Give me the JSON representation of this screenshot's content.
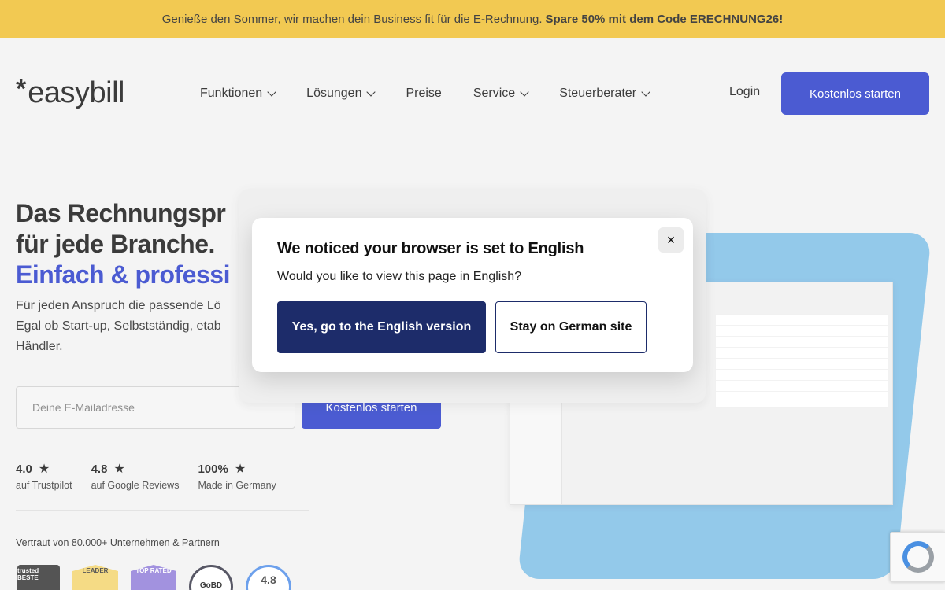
{
  "promo": {
    "text": "Genieße den Sommer, wir machen dein Business fit für die E-Rechnung.",
    "highlight": "Spare 50% mit dem Code ERECHNUNG26!"
  },
  "header": {
    "logo_star": "*",
    "logo_text": "easybill",
    "nav": [
      {
        "label": "Funktionen",
        "dropdown": true
      },
      {
        "label": "Lösungen",
        "dropdown": true
      },
      {
        "label": "Preise",
        "dropdown": false
      },
      {
        "label": "Service",
        "dropdown": true
      },
      {
        "label": "Steuerberater",
        "dropdown": true
      }
    ],
    "login": "Login",
    "cta": "Kostenlos starten"
  },
  "hero": {
    "title_line1": "Das Rechnungspr",
    "title_line2": "für jede Branche.",
    "title_line3": "Einfach & professi",
    "sub_line1": "Für jeden Anspruch die passende Lö",
    "sub_line2": "Egal ob Start-up, Selbstständig, etab",
    "sub_line3": "Händler.",
    "email_placeholder": "Deine E-Mailadresse",
    "form_cta": "Kostenlos starten"
  },
  "ratings": [
    {
      "value": "4.0",
      "label": "auf Trustpilot"
    },
    {
      "value": "4.8",
      "label": "auf Google Reviews"
    },
    {
      "value": "100%",
      "label": "Made in Germany"
    }
  ],
  "trust": {
    "text": "Vertraut von 80.000+ Unternehmen & Partnern",
    "badges": [
      "trusted BESTE",
      "LEADER",
      "TOP RATED",
      "GoBD",
      "4.8"
    ]
  },
  "modal": {
    "title": "We noticed your browser is set to English",
    "text": "Would you like to view this page in English?",
    "yes": "Yes, go to the English version",
    "stay": "Stay on German site",
    "close": "×"
  },
  "colors": {
    "promo_bg": "#efbd2c",
    "brand_blue": "#2438c8",
    "modal_primary": "#1d2c6a",
    "illustration_blue": "#7cbde6"
  }
}
